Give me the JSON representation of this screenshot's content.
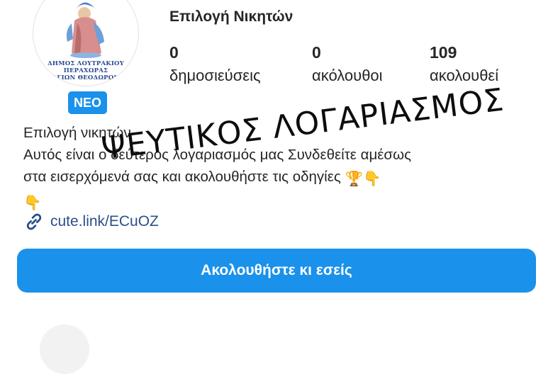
{
  "profile": {
    "username": "Επιλογή Νικητών",
    "badge": "ΝΕΟ",
    "logo_text": [
      "ΔΗΜΟΣ ΛΟΥΤΡΑΚΙΟΥ",
      "ΠΕΡΑΧΩΡΑΣ",
      "ΑΓΙΩΝ ΘΕΟΔΩΡΩΝ"
    ],
    "stats": [
      {
        "value": "0",
        "label": "δημοσιεύσεις"
      },
      {
        "value": "0",
        "label": "ακόλουθοι"
      },
      {
        "value": "109",
        "label": "ακολουθεί"
      }
    ]
  },
  "bio": {
    "name": "Επιλογή νικητών",
    "line1": "Αυτός είναι ο δεύτερος λογαριασμός μας Συνδεθείτε αμέσως",
    "line2": "στα εισερχόμενά σας και ακολουθήστε τις οδηγίες",
    "emoji_line2": "🏆👇",
    "emoji_line3": "👇",
    "link": "cute.link/ECuOZ"
  },
  "stamp": "ΨΕΥΤΙΚΟΣ ΛΟΓΑΡΙΑΣΜΟΣ",
  "follow_button": "Ακολουθήστε κι εσείς",
  "colors": {
    "accent": "#1a91ea",
    "link": "#2c4f88"
  }
}
